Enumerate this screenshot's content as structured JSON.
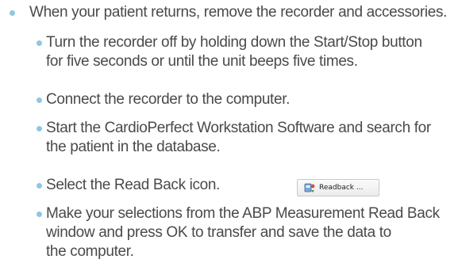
{
  "instructions": {
    "main": "When your patient returns, remove the recorder and accessories.",
    "steps": [
      {
        "lines": [
          "Turn the recorder off by holding down the Start/Stop button",
          "for five seconds or until the unit beeps five times."
        ]
      },
      {
        "lines": [
          "Connect the recorder to the computer."
        ]
      },
      {
        "lines": [
          "Start the CardioPerfect Workstation Software and search for",
          "the patient in the database."
        ]
      },
      {
        "lines": [
          "Select the Read Back icon."
        ],
        "button_label": "Readback ...",
        "button_icon": "readback-icon"
      },
      {
        "lines": [
          "Make your selections from the ABP Measurement Read Back",
          "window and press OK to transfer and save the data to",
          "the computer."
        ]
      }
    ]
  },
  "colors": {
    "bullet": "#8ec7e3",
    "text": "#4a4a4a"
  }
}
